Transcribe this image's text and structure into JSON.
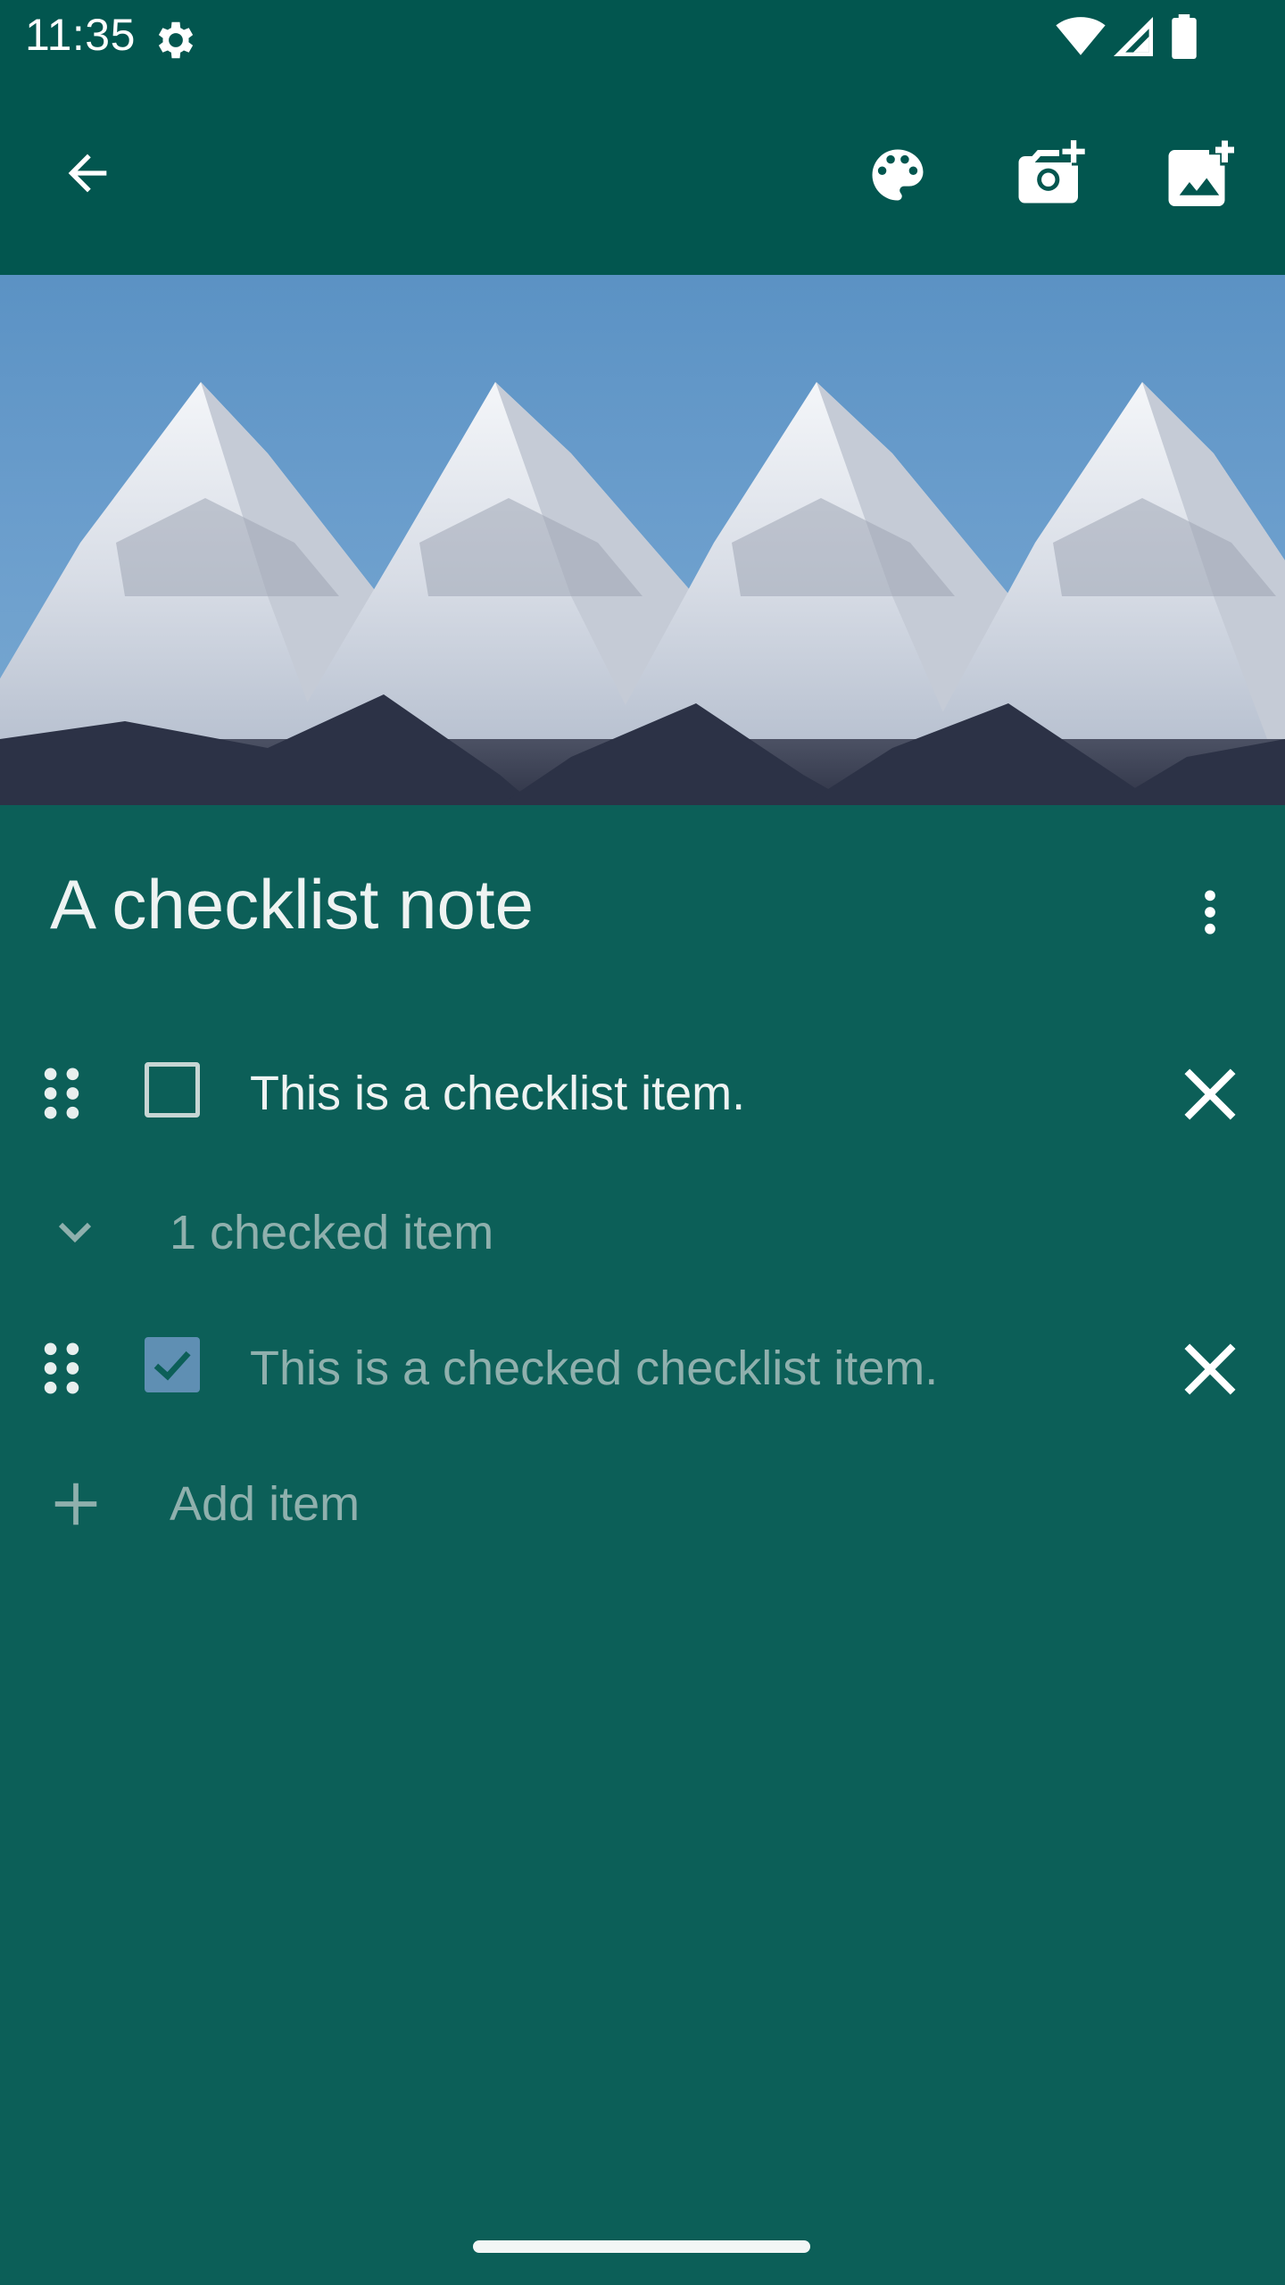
{
  "status_bar": {
    "time": "11:35",
    "icons": [
      "settings-gear-icon",
      "wifi-icon",
      "signal-icon",
      "battery-icon"
    ]
  },
  "toolbar": {
    "icons": [
      "back-arrow-icon",
      "palette-icon",
      "add-camera-icon",
      "add-image-icon"
    ]
  },
  "note": {
    "title": "A checklist note",
    "more_icon": "more-vert-icon",
    "banner_image": "snowy-mountain-peaks"
  },
  "checklist": {
    "unchecked_items": [
      {
        "text": "This is a checklist item.",
        "checked": false
      }
    ],
    "checked_header": "1 checked item",
    "checked_items": [
      {
        "text": "This is a checked checklist item.",
        "checked": true
      }
    ],
    "add_item_label": "Add item"
  },
  "colors": {
    "background": "#0c5f58",
    "app_bar": "#02564f",
    "checkbox_checked": "#5f8fb3",
    "muted_text": "#8fb0ad"
  }
}
